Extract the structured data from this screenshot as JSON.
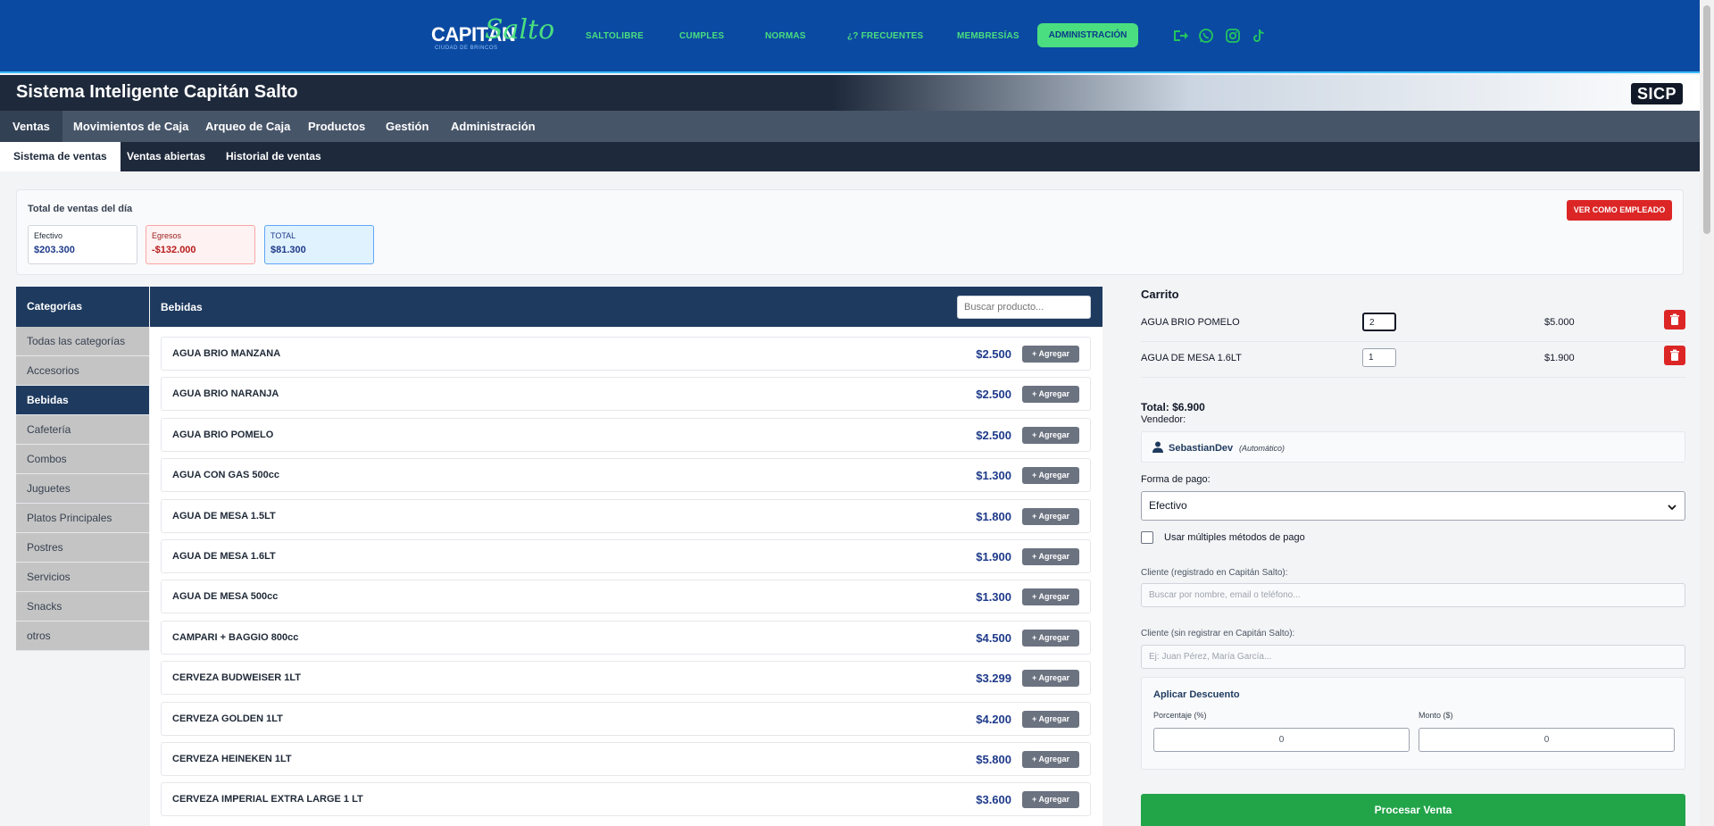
{
  "brand": {
    "logo_main": "CAPITÁN",
    "logo_script": "Salto",
    "logo_tagline": "CIUDAD DE BRINCOS"
  },
  "site_nav": {
    "links": [
      "SALTOLIBRE",
      "CUMPLES",
      "NORMAS",
      "¿? FRECUENTES",
      "MEMBRESÍAS"
    ],
    "admin_button": "ADMINISTRACIÓN",
    "icons": [
      "logout-icon",
      "whatsapp-icon",
      "instagram-icon",
      "tiktok-icon"
    ],
    "accent_color": "#4ade80",
    "bg_color": "#0b4aa2"
  },
  "header": {
    "title": "Sistema Inteligente Capitán Salto",
    "badge": "SICP"
  },
  "main_tabs": [
    "Ventas",
    "Movimientos de Caja",
    "Arqueo de Caja",
    "Productos",
    "Gestión",
    "Administración"
  ],
  "sub_tabs": [
    "Sistema de ventas",
    "Ventas abiertas",
    "Historial de ventas"
  ],
  "daily_totals": {
    "title": "Total de ventas del día",
    "cards": [
      {
        "label": "Efectivo",
        "value": "$203.300"
      },
      {
        "label": "Egresos",
        "value": "-$132.000"
      },
      {
        "label": "TOTAL",
        "value": "$81.300"
      }
    ],
    "employee_button": "VER COMO EMPLEADO"
  },
  "categories": {
    "title": "Categorías",
    "items": [
      "Todas las categorías",
      "Accesorios",
      "Bebidas",
      "Cafetería",
      "Combos",
      "Juguetes",
      "Platos Principales",
      "Postres",
      "Servicios",
      "Snacks",
      "otros"
    ],
    "active": "Bebidas"
  },
  "products": {
    "title": "Bebidas",
    "search_placeholder": "Buscar producto...",
    "add_label": "+ Agregar",
    "items": [
      {
        "name": "AGUA BRIO MANZANA",
        "price": "$2.500"
      },
      {
        "name": "AGUA BRIO NARANJA",
        "price": "$2.500"
      },
      {
        "name": "AGUA BRIO POMELO",
        "price": "$2.500"
      },
      {
        "name": "AGUA CON GAS 500cc",
        "price": "$1.300"
      },
      {
        "name": "AGUA DE MESA 1.5LT",
        "price": "$1.800"
      },
      {
        "name": "AGUA DE MESA 1.6LT",
        "price": "$1.900"
      },
      {
        "name": "AGUA DE MESA 500cc",
        "price": "$1.300"
      },
      {
        "name": "CAMPARI + BAGGIO 800cc",
        "price": "$4.500"
      },
      {
        "name": "CERVEZA BUDWEISER 1LT",
        "price": "$3.299"
      },
      {
        "name": "CERVEZA GOLDEN 1LT",
        "price": "$4.200"
      },
      {
        "name": "CERVEZA HEINEKEN 1LT",
        "price": "$5.800"
      },
      {
        "name": "CERVEZA IMPERIAL EXTRA LARGE 1 LT",
        "price": "$3.600"
      }
    ]
  },
  "cart": {
    "title": "Carrito",
    "items": [
      {
        "name": "AGUA BRIO POMELO",
        "qty": "2",
        "price": "$5.000"
      },
      {
        "name": "AGUA DE MESA 1.6LT",
        "qty": "1",
        "price": "$1.900"
      }
    ],
    "total": "Total: $6.900",
    "seller_label": "Vendedor:",
    "seller_name": "SebastianDev",
    "seller_auto": "(Automático)",
    "payment_label": "Forma de pago:",
    "payment_value": "Efectivo",
    "multi_payment_label": "Usar múltiples métodos de pago",
    "client_registered_label": "Cliente (registrado en Capitán Salto):",
    "client_registered_placeholder": "Buscar por nombre, email o teléfono...",
    "client_unregistered_label": "Cliente (sin registrar en Capitán Salto):",
    "client_unregistered_placeholder": "Ej: Juan Pérez, María García...",
    "discount_title": "Aplicar Descuento",
    "discount_pct_label": "Porcentaje (%)",
    "discount_pct_value": "0",
    "discount_amt_label": "Monto ($)",
    "discount_amt_value": "0",
    "process_button": "Procesar Venta"
  }
}
